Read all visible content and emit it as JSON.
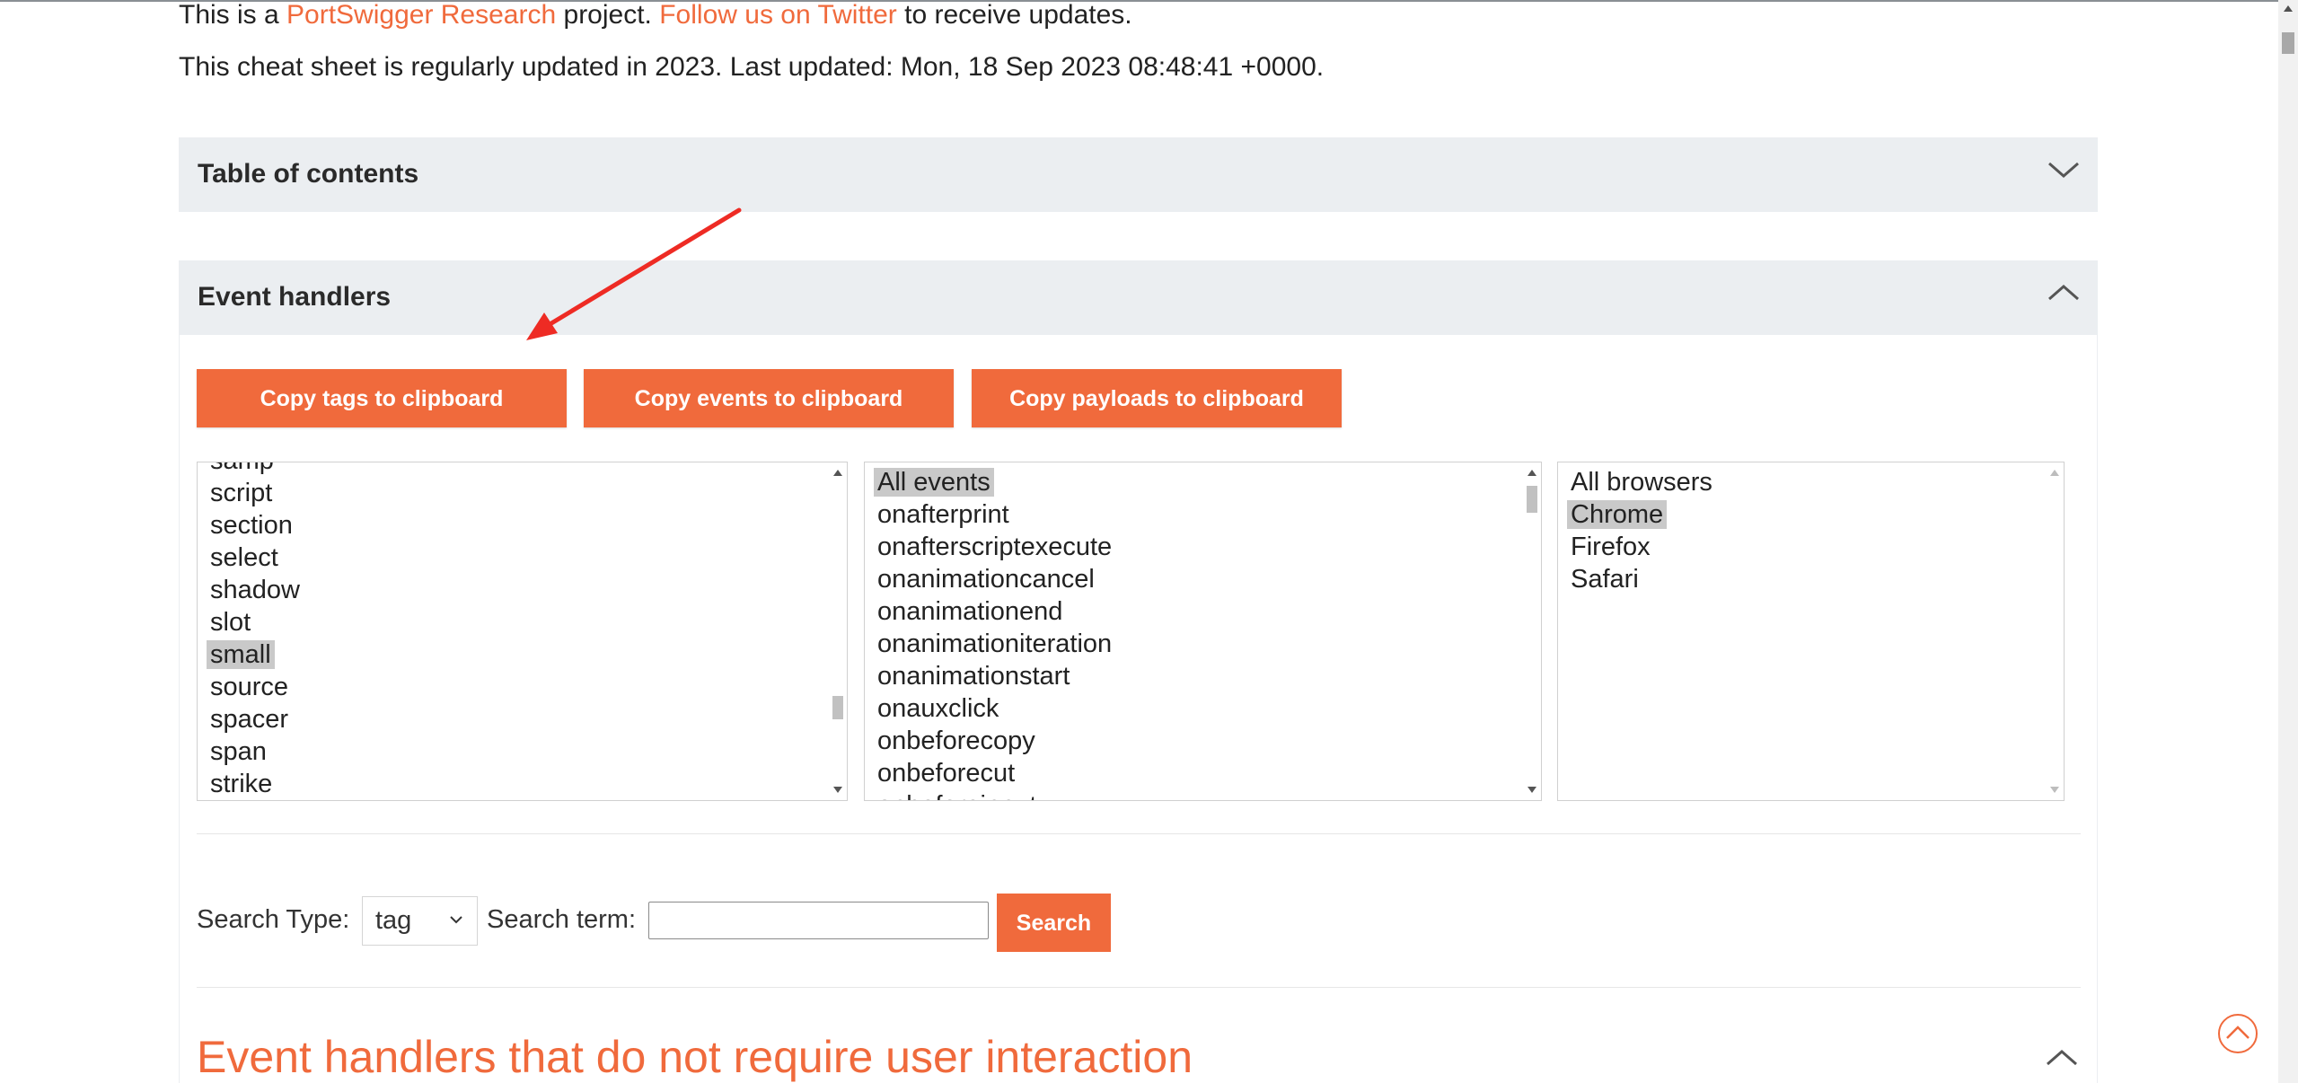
{
  "intro": {
    "line1_prefix": "This is a ",
    "line1_link1": "PortSwigger Research",
    "line1_mid": " project. ",
    "line1_link2": "Follow us on Twitter",
    "line1_suffix": " to receive updates.",
    "line2": "This cheat sheet is regularly updated in 2023. Last updated: Mon, 18 Sep 2023 08:48:41 +0000."
  },
  "toc": {
    "title": "Table of contents",
    "icon": "chevron-down-icon"
  },
  "event_handlers": {
    "title": "Event handlers",
    "icon": "chevron-up-icon",
    "buttons": {
      "copy_tags": "Copy tags to clipboard",
      "copy_events": "Copy events to clipboard",
      "copy_payloads": "Copy payloads to clipboard"
    },
    "tags": [
      "samp",
      "script",
      "section",
      "select",
      "shadow",
      "slot",
      "small",
      "source",
      "spacer",
      "span",
      "strike"
    ],
    "tags_selected": "small",
    "events": [
      "All events",
      "onafterprint",
      "onafterscriptexecute",
      "onanimationcancel",
      "onanimationend",
      "onanimationiteration",
      "onanimationstart",
      "onauxclick",
      "onbeforecopy",
      "onbeforecut",
      "onbeforeinput"
    ],
    "events_selected": "All events",
    "browsers": [
      "All browsers",
      "Chrome",
      "Firefox",
      "Safari"
    ],
    "browsers_selected": "Chrome",
    "search": {
      "type_label": "Search Type:",
      "type_value": "tag",
      "term_label": "Search term:",
      "term_value": "",
      "button": "Search"
    }
  },
  "section": {
    "title": "Event handlers that do not require user interaction",
    "icon": "chevron-up-icon"
  },
  "colors": {
    "accent": "#f06a3c",
    "panel": "#ebeef1",
    "selection": "#c9c9c9"
  },
  "annotation": {
    "type": "red-arrow",
    "color": "#ee2b24"
  }
}
